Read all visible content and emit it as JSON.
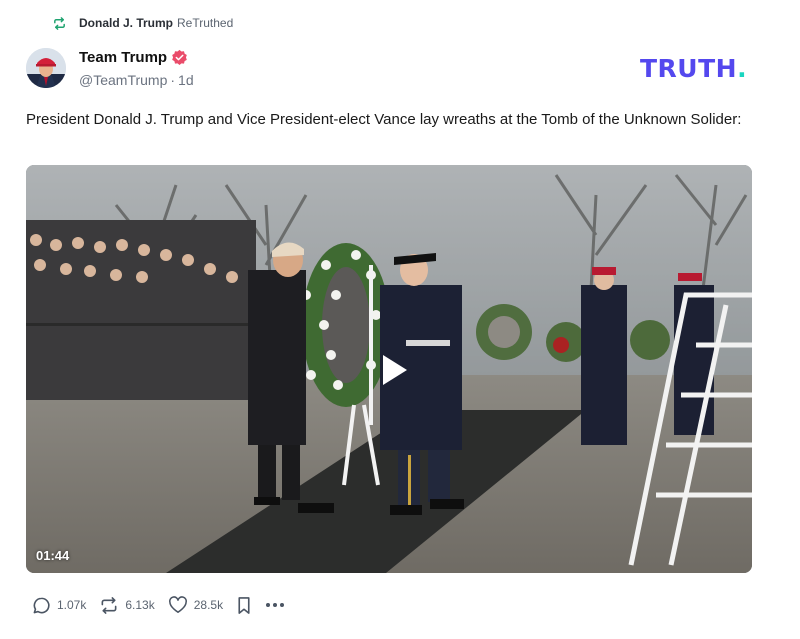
{
  "retruth": {
    "user": "Donald J. Trump",
    "label": "ReTruthed"
  },
  "author": {
    "name": "Team Trump",
    "handle": "@TeamTrump",
    "separator": "·",
    "time": "1d",
    "verified_color": "#ea4c6a"
  },
  "brand": {
    "logo_text": "TRUTH",
    "logo_dot": ".",
    "color": "#5448ee",
    "dot_color": "#1ad6c0"
  },
  "post": {
    "text": "President Donald J. Trump and Vice President-elect Vance lay wreaths at the Tomb of the Unknown Solider:"
  },
  "video": {
    "duration": "01:44",
    "play_icon": "play-icon"
  },
  "actions": {
    "replies": "1.07k",
    "retruths": "6.13k",
    "likes": "28.5k",
    "icons": [
      "reply-icon",
      "retruth-icon",
      "like-icon",
      "bookmark-icon",
      "more-icon"
    ]
  }
}
